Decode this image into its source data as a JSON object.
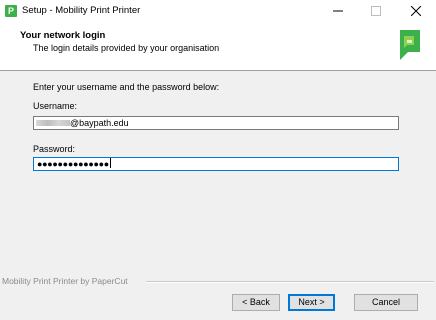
{
  "window": {
    "title": "Setup - Mobility Print Printer",
    "app_icon_letter": "P",
    "controls": [
      "minimize-icon",
      "maximize-icon",
      "close-icon"
    ]
  },
  "header": {
    "title": "Your network login",
    "subtitle": "The login details provided by your organisation",
    "logo": "papercut-logo"
  },
  "form": {
    "instruction": "Enter your username and the password below:",
    "username_label": "Username:",
    "username_value": "@baypath.edu",
    "password_label": "Password:",
    "password_value": "●●●●●●●●●●●●●●"
  },
  "footer": {
    "brand": "Mobility Print Printer by PaperCut"
  },
  "buttons": {
    "back": "< Back",
    "next": "Next >",
    "cancel": "Cancel"
  },
  "colors": {
    "accent": "#0078d7",
    "logo_green": "#3cb04a"
  }
}
